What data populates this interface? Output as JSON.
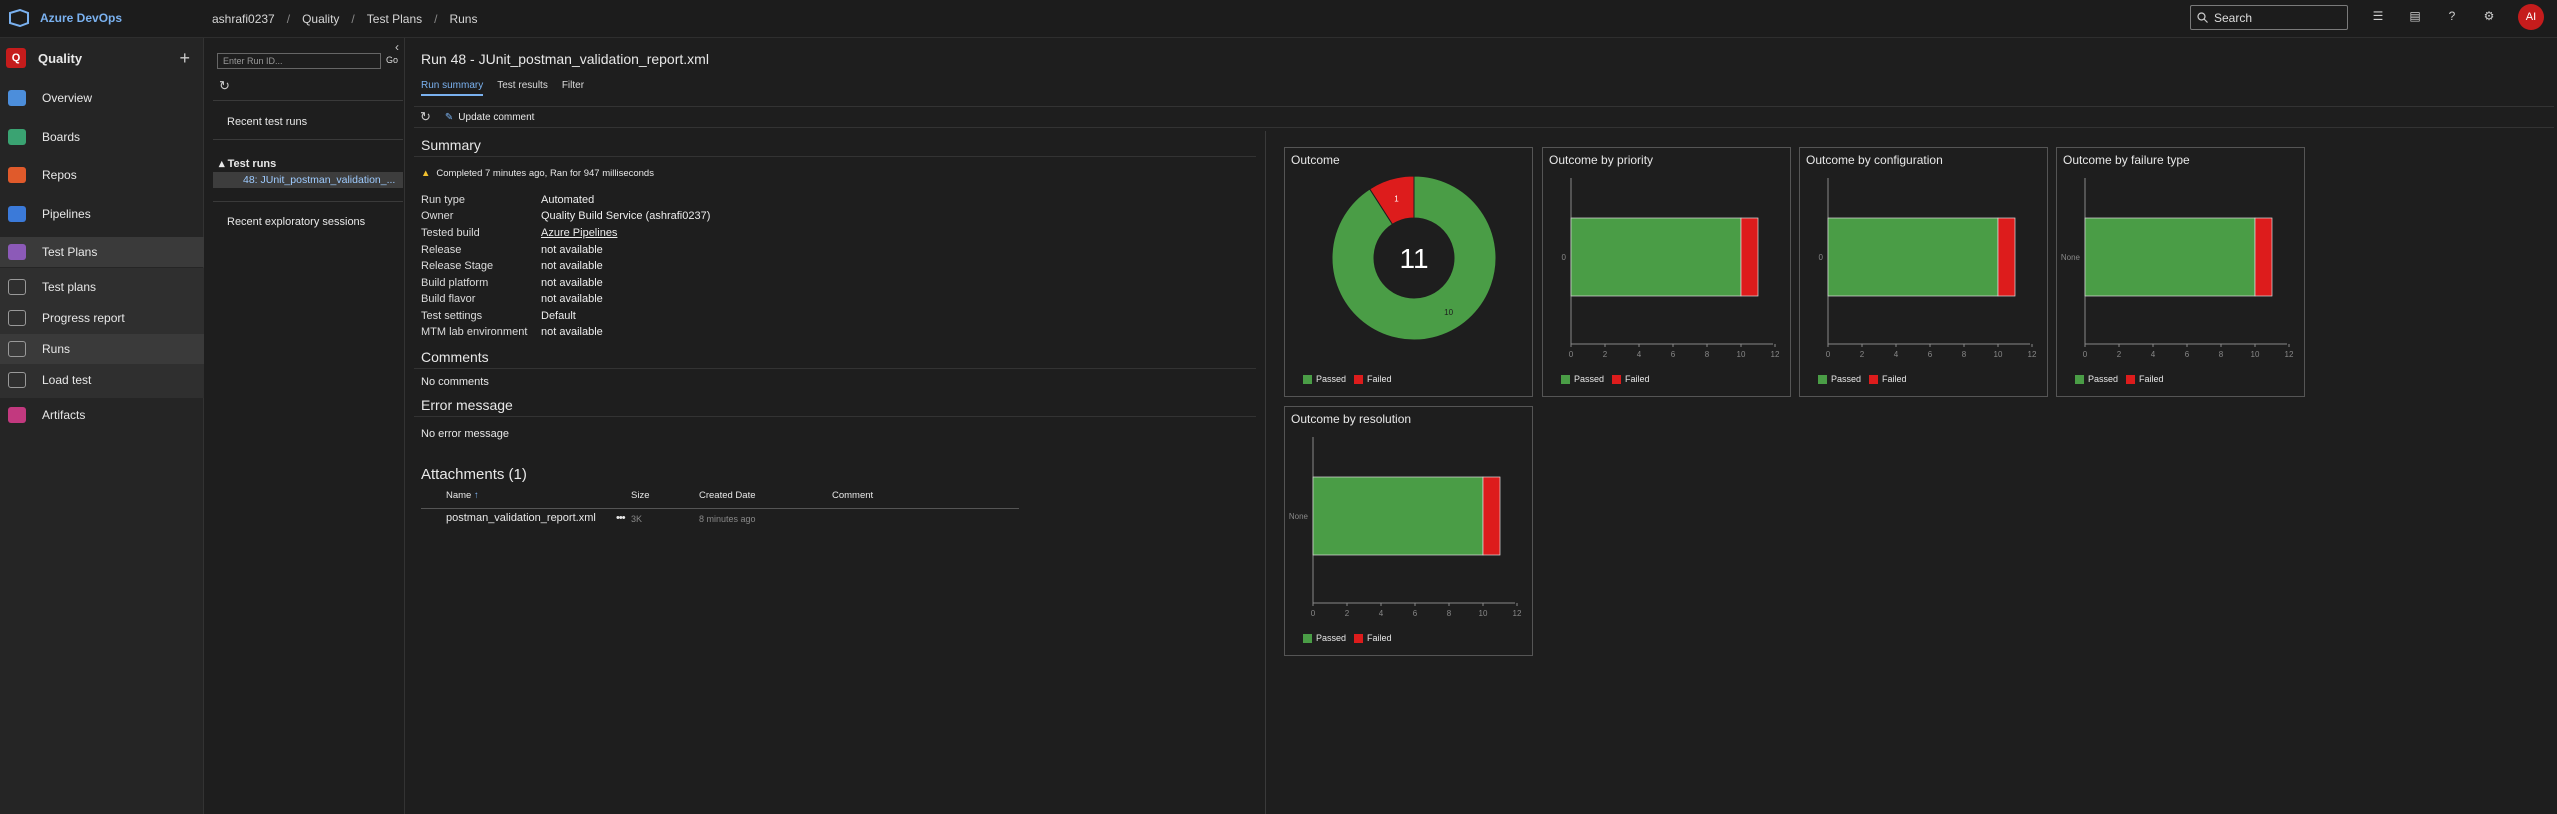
{
  "topbar": {
    "brand": "Azure DevOps",
    "breadcrumbs": [
      "ashrafi0237",
      "Quality",
      "Test Plans",
      "Runs"
    ],
    "search_placeholder": "Search",
    "avatar_initials": "AI"
  },
  "project": {
    "badge": "Q",
    "name": "Quality"
  },
  "nav": [
    {
      "label": "Overview",
      "color": "#4c8edb"
    },
    {
      "label": "Boards",
      "color": "#3aa372"
    },
    {
      "label": "Repos",
      "color": "#e05a2b"
    },
    {
      "label": "Pipelines",
      "color": "#3b7ad9"
    },
    {
      "label": "Test Plans",
      "color": "#8c5ab8"
    },
    {
      "label": "Test plans",
      "color": "#666"
    },
    {
      "label": "Progress report",
      "color": "#666"
    },
    {
      "label": "Runs",
      "color": "#666"
    },
    {
      "label": "Load test",
      "color": "#666"
    },
    {
      "label": "Artifacts",
      "color": "#c2397f"
    }
  ],
  "panel": {
    "runid_placeholder": "Enter Run ID...",
    "go": "Go",
    "recent_test_runs": "Recent test runs",
    "test_runs_header": "Test runs",
    "selected_run": "48: JUnit_postman_validation_...",
    "recent_exploratory": "Recent exploratory sessions"
  },
  "main": {
    "title": "Run 48 - JUnit_postman_validation_report.xml",
    "tabs": [
      "Run summary",
      "Test results",
      "Filter"
    ],
    "update_comment": "Update comment",
    "summary_header": "Summary",
    "status": "Completed 7 minutes ago, Ran for 947 milliseconds",
    "properties": [
      {
        "k": "Run type",
        "v": "Automated"
      },
      {
        "k": "Owner",
        "v": "Quality Build Service (ashrafi0237)"
      },
      {
        "k": "Tested build",
        "v": "Azure Pipelines"
      },
      {
        "k": "Release",
        "v": "not available"
      },
      {
        "k": "Release Stage",
        "v": "not available"
      },
      {
        "k": "Build platform",
        "v": "not available"
      },
      {
        "k": "Build flavor",
        "v": "not available"
      },
      {
        "k": "Test settings",
        "v": "Default"
      },
      {
        "k": "MTM lab environment",
        "v": "not available"
      }
    ],
    "comments_header": "Comments",
    "no_comments": "No comments",
    "error_header": "Error message",
    "no_error": "No error message",
    "attachments_header": "Attachments (1)",
    "att_cols": [
      "Name",
      "Size",
      "Created Date",
      "Comment"
    ],
    "att_row": {
      "name": "postman_validation_report.xml",
      "size": "3K",
      "date": "8 minutes ago",
      "comment": ""
    }
  },
  "legend": {
    "passed": "Passed",
    "failed": "Failed"
  },
  "colors": {
    "passed": "#4a9d46",
    "failed": "#dd1c1c",
    "accent": "#7ab1ef"
  },
  "chart_data": [
    {
      "type": "pie",
      "title": "Outcome",
      "total_label": "11",
      "labels": [
        "Passed",
        "Failed"
      ],
      "values": [
        10,
        1
      ]
    },
    {
      "type": "bar",
      "title": "Outcome by priority",
      "orientation": "horizontal",
      "stacked": true,
      "categories": [
        "0"
      ],
      "series": [
        {
          "name": "Passed",
          "values": [
            10
          ]
        },
        {
          "name": "Failed",
          "values": [
            1
          ]
        }
      ],
      "xticks": [
        "0",
        "2",
        "4",
        "6",
        "8",
        "10",
        "12"
      ],
      "xlim": [
        0,
        12
      ]
    },
    {
      "type": "bar",
      "title": "Outcome by configuration",
      "orientation": "horizontal",
      "stacked": true,
      "categories": [
        "0"
      ],
      "series": [
        {
          "name": "Passed",
          "values": [
            10
          ]
        },
        {
          "name": "Failed",
          "values": [
            1
          ]
        }
      ],
      "xticks": [
        "0",
        "2",
        "4",
        "6",
        "8",
        "10",
        "12"
      ],
      "xlim": [
        0,
        12
      ]
    },
    {
      "type": "bar",
      "title": "Outcome by failure type",
      "orientation": "horizontal",
      "stacked": true,
      "categories": [
        "None"
      ],
      "series": [
        {
          "name": "Passed",
          "values": [
            10
          ]
        },
        {
          "name": "Failed",
          "values": [
            1
          ]
        }
      ],
      "xticks": [
        "0",
        "2",
        "4",
        "6",
        "8",
        "10",
        "12"
      ],
      "xlim": [
        0,
        12
      ]
    },
    {
      "type": "bar",
      "title": "Outcome by resolution",
      "orientation": "horizontal",
      "stacked": true,
      "categories": [
        "None"
      ],
      "series": [
        {
          "name": "Passed",
          "values": [
            10
          ]
        },
        {
          "name": "Failed",
          "values": [
            1
          ]
        }
      ],
      "xticks": [
        "0",
        "2",
        "4",
        "6",
        "8",
        "10",
        "12"
      ],
      "xlim": [
        0,
        12
      ]
    }
  ]
}
